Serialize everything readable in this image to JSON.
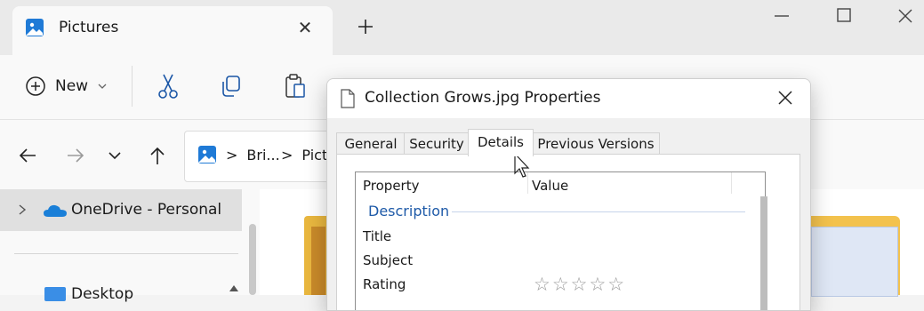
{
  "window": {
    "tab_title": "Pictures",
    "tab_close": "✕",
    "new_tab": "+"
  },
  "command_bar": {
    "new_label": "New"
  },
  "address": {
    "crumbs": [
      "Bri...",
      "Pictu"
    ],
    "separator": ">"
  },
  "nav": {
    "onedrive_label": "OneDrive - Personal",
    "desktop_label": "Desktop"
  },
  "dialog": {
    "title": "Collection Grows.jpg Properties",
    "tabs": [
      "General",
      "Security",
      "Details",
      "Previous Versions"
    ],
    "active_tab": "Details",
    "columns": [
      "Property",
      "Value"
    ],
    "group": "Description",
    "rows": [
      "Title",
      "Subject",
      "Rating"
    ],
    "rating_stars": "☆☆☆☆☆"
  },
  "colors": {
    "accent": "#1e5aa8",
    "folder": "#f3c24d"
  }
}
